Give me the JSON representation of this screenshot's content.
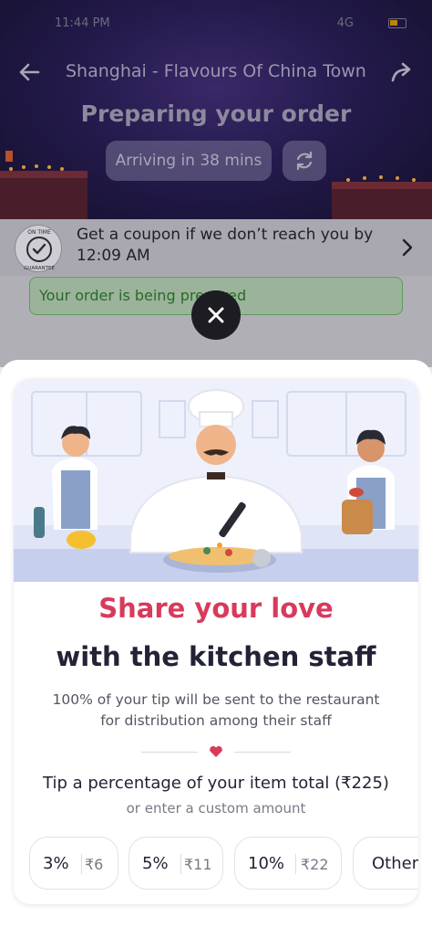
{
  "status_bar": {
    "time": "11:44 PM",
    "signal": "4G"
  },
  "header": {
    "restaurant_name": "Shanghai - Flavours Of China Town",
    "status_title": "Preparing your order",
    "eta": "Arriving in 38 mins"
  },
  "coupon": {
    "badge_text": "ON TIME GUARANTEE",
    "text": "Get a coupon if we don’t reach you by 12:09 AM"
  },
  "order_status": {
    "text": "Your order is being prepared"
  },
  "tip_sheet": {
    "title_line1": "Share your love",
    "title_line2": "with the kitchen staff",
    "description": "100% of your tip will be sent to the restaurant for distribution among their staff",
    "tip_prompt": "Tip a percentage of your item total (₹225)",
    "custom_prompt": "or enter a custom amount",
    "options": [
      {
        "percent": "3%",
        "amount": "₹6"
      },
      {
        "percent": "5%",
        "amount": "₹11"
      },
      {
        "percent": "10%",
        "amount": "₹22"
      },
      {
        "percent": "Other"
      }
    ]
  },
  "colors": {
    "accent_pink": "#d83a5c",
    "dark_text": "#232336",
    "overlay_header": "#241a4c",
    "close_button": "#1c1c22"
  }
}
